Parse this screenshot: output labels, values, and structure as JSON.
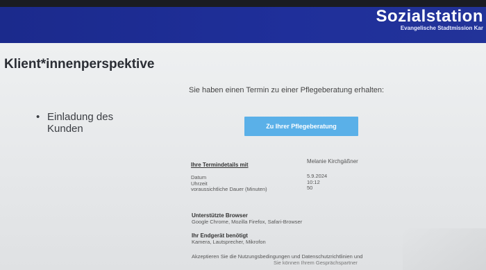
{
  "header": {
    "brand_name": "Sozialstation",
    "brand_subtitle": "Evangelische Stadtmission Kar"
  },
  "slide": {
    "title": "Klient*innenperspektive",
    "bullet_symbol": "•",
    "bullet_text": "Einladung des Kunden"
  },
  "email": {
    "intro": "Sie haben einen Termin zu einer Pflegeberatung erhalten:",
    "button_label": "Zu Ihrer Pflegeberatung",
    "details_heading": "Ihre Termindetails mit",
    "organizer": "Melanie Kirchgäßner",
    "details": [
      {
        "label": "Datum",
        "value": "5.9.2024"
      },
      {
        "label": "Uhrzeit",
        "value": "10:12"
      },
      {
        "label": "voraussichtliche Dauer (Minuten)",
        "value": "50"
      }
    ],
    "browsers_heading": "Unterstützte Browser",
    "browsers_text": "Google Chrome, Mozilla Firefox, Safari-Browser",
    "device_heading": "Ihr Endgerät benötigt",
    "device_text": "Kamera, Lautsprecher, Mikrofon",
    "terms_line1": "Akzeptieren Sie die Nutzungsbedingungen und Datenschutzrichtlinien und",
    "terms_line2": "Sie können Ihrem Gesprächspartner"
  },
  "colors": {
    "header_blue": "#1f2f9a",
    "button_blue": "#5ab0e8"
  }
}
